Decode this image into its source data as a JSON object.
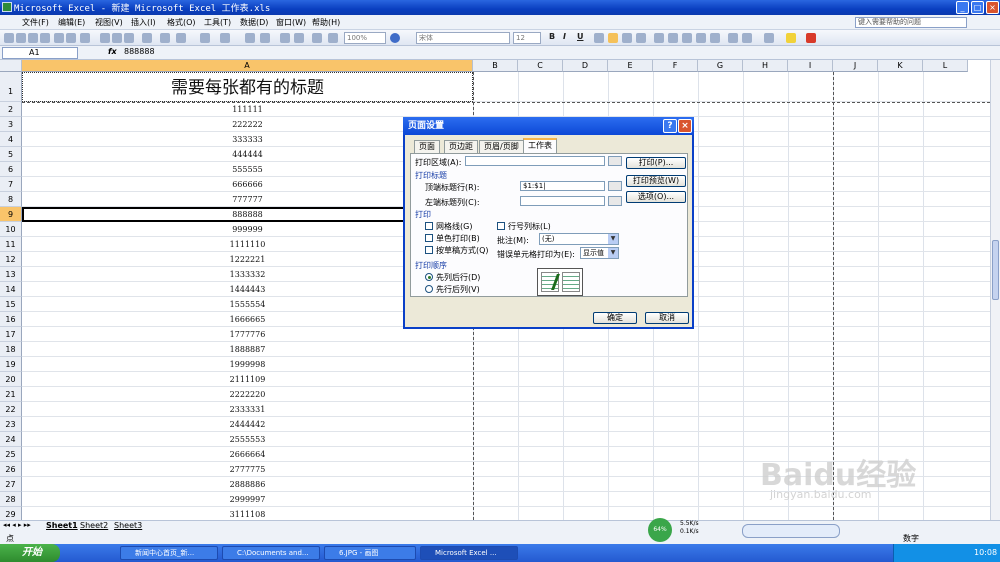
{
  "window": {
    "title": "Microsoft Excel - 新建 Microsoft Excel 工作表.xls"
  },
  "menu": {
    "items": [
      "文件(F)",
      "编辑(E)",
      "视图(V)",
      "插入(I)",
      "格式(O)",
      "工具(T)",
      "数据(D)",
      "窗口(W)",
      "帮助(H)"
    ],
    "help_placeholder": "键入需要帮助的问题"
  },
  "toolbar": {
    "zoom": "100%",
    "font": "宋体",
    "font_size": "12",
    "bold": "B",
    "italic": "I",
    "underline": "U"
  },
  "formula": {
    "cell_ref": "A1",
    "fx": "fx",
    "value": "888888"
  },
  "columns": [
    "A",
    "B",
    "C",
    "D",
    "E",
    "F",
    "G",
    "H",
    "I",
    "J",
    "K",
    "L"
  ],
  "rows": [
    {
      "n": "1",
      "v": "需要每张都有的标题"
    },
    {
      "n": "2",
      "v": "111111"
    },
    {
      "n": "3",
      "v": "222222"
    },
    {
      "n": "4",
      "v": "333333"
    },
    {
      "n": "5",
      "v": "444444"
    },
    {
      "n": "6",
      "v": "555555"
    },
    {
      "n": "7",
      "v": "666666"
    },
    {
      "n": "8",
      "v": "777777"
    },
    {
      "n": "9",
      "v": "888888"
    },
    {
      "n": "10",
      "v": "999999"
    },
    {
      "n": "11",
      "v": "1111110"
    },
    {
      "n": "12",
      "v": "1222221"
    },
    {
      "n": "13",
      "v": "1333332"
    },
    {
      "n": "14",
      "v": "1444443"
    },
    {
      "n": "15",
      "v": "1555554"
    },
    {
      "n": "16",
      "v": "1666665"
    },
    {
      "n": "17",
      "v": "1777776"
    },
    {
      "n": "18",
      "v": "1888887"
    },
    {
      "n": "19",
      "v": "1999998"
    },
    {
      "n": "20",
      "v": "2111109"
    },
    {
      "n": "21",
      "v": "2222220"
    },
    {
      "n": "22",
      "v": "2333331"
    },
    {
      "n": "23",
      "v": "2444442"
    },
    {
      "n": "24",
      "v": "2555553"
    },
    {
      "n": "25",
      "v": "2666664"
    },
    {
      "n": "26",
      "v": "2777775"
    },
    {
      "n": "27",
      "v": "2888886"
    },
    {
      "n": "28",
      "v": "2999997"
    },
    {
      "n": "29",
      "v": "3111108"
    }
  ],
  "sheets": [
    "Sheet1",
    "Sheet2",
    "Sheet3"
  ],
  "status": {
    "left": "点",
    "right": "数字",
    "net_pct": "64%",
    "up": "5.5K/s",
    "down": "0.1K/s"
  },
  "dialog": {
    "title": "页面设置",
    "tabs": [
      "页面",
      "页边距",
      "页眉/页脚",
      "工作表"
    ],
    "print_area_label": "打印区域(A):",
    "print_titles_group": "打印标题",
    "top_rows_label": "顶端标题行(R):",
    "top_rows_value": "$1:$1|",
    "left_cols_label": "左端标题列(C):",
    "print_group": "打印",
    "gridlines": "网格线(G)",
    "mono": "单色打印(B)",
    "draft": "按草稿方式(Q)",
    "row_col_headers": "行号列标(L)",
    "comments_label": "批注(M):",
    "comments_value": "(无)",
    "errors_label": "错误单元格打印为(E):",
    "errors_value": "显示值",
    "order_group": "打印顺序",
    "down_then_over": "先列后行(D)",
    "over_then_down": "先行后列(V)",
    "print_btn": "打印(P)...",
    "preview_btn": "打印预览(W)",
    "options_btn": "选项(O)...",
    "ok_btn": "确定",
    "cancel_btn": "取消"
  },
  "taskbar": {
    "start": "开始",
    "tasks": [
      "新闻中心首页_新...",
      "C:\\Documents and...",
      "6.JPG - 画图",
      "Microsoft Excel ..."
    ],
    "clock": "10:08"
  },
  "watermark": {
    "text": "Baidu经验",
    "url": "jingyan.baidu.com"
  }
}
